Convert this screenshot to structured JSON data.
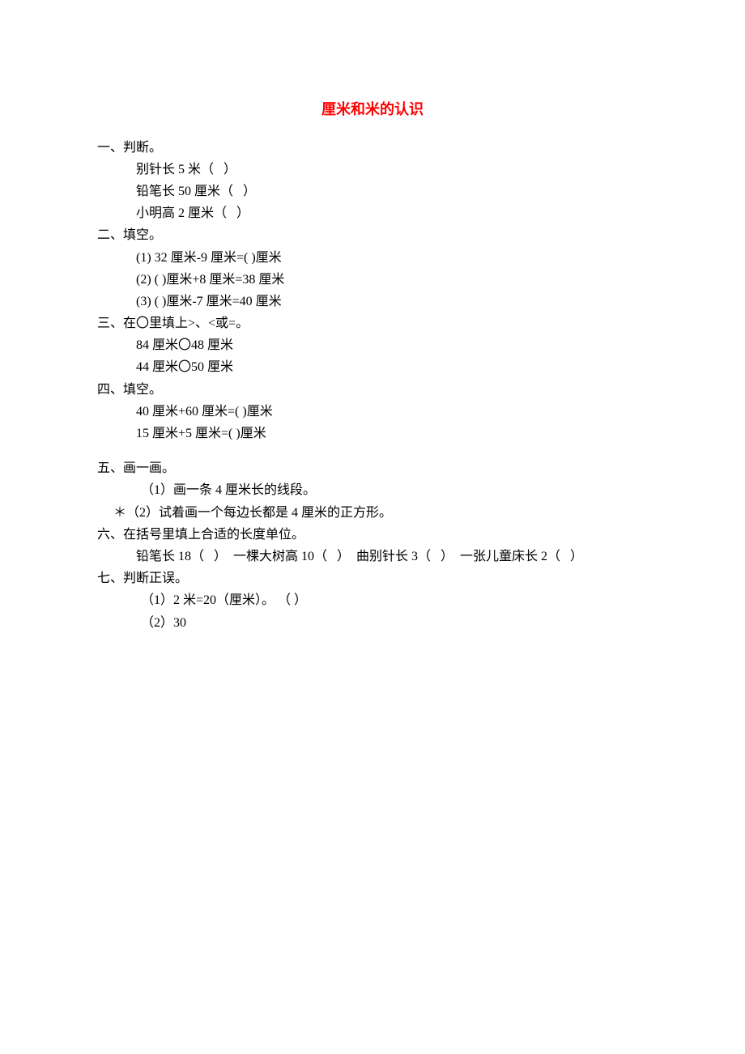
{
  "title": "厘米和米的认识",
  "s1": {
    "heading": "一、判断。",
    "items": [
      "别针长 5 米（   ）",
      "铅笔长 50 厘米（   ）",
      "小明高 2 厘米（   ）"
    ]
  },
  "s2": {
    "heading": "二、填空。",
    "items": [
      "(1) 32 厘米-9 厘米=( )厘米",
      "(2) ( )厘米+8 厘米=38 厘米",
      "(3) ( )厘米-7 厘米=40 厘米"
    ]
  },
  "s3": {
    "heading": "三、在〇里填上>、<或=。",
    "items": [
      "84 厘米〇48 厘米",
      "44 厘米〇50 厘米"
    ]
  },
  "s4": {
    "heading": "四、填空。",
    "items": [
      "40 厘米+60 厘米=( )厘米",
      "15 厘米+5 厘米=( )厘米"
    ]
  },
  "s5": {
    "heading": "五、画一画。",
    "items": [
      "（1）画一条 4 厘米长的线段。",
      "＊（2）试着画一个每边长都是 4 厘米的正方形。"
    ]
  },
  "s6": {
    "heading": "六、在括号里填上合适的长度单位。",
    "line": "铅笔长 18（   ）  一棵大树高 10（   ）  曲别针长 3（   ）  一张儿童床长 2（   ）"
  },
  "s7": {
    "heading": "七、判断正误。",
    "items": [
      "（1）2 米=20（厘米）。 （ ）",
      "（2）30"
    ]
  }
}
